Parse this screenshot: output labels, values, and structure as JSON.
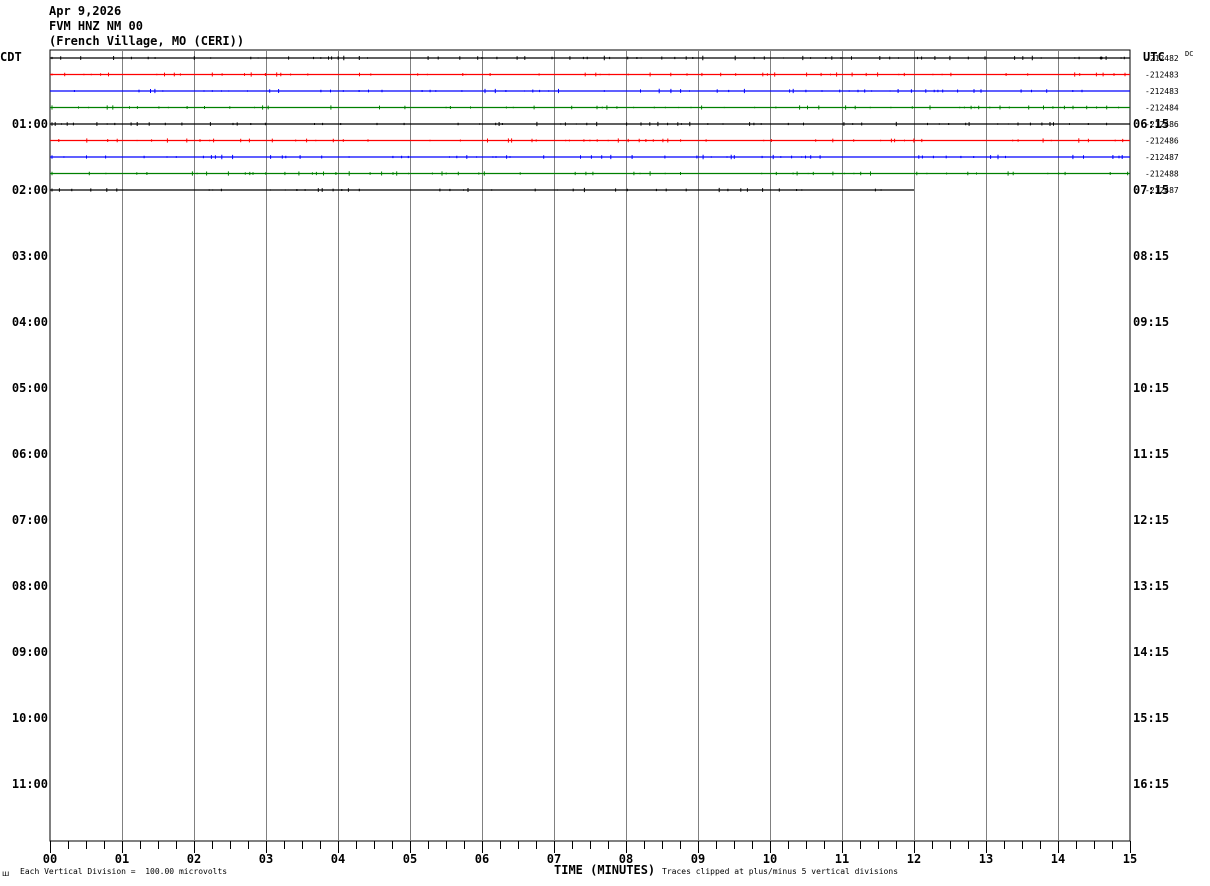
{
  "header": {
    "date": "Apr 9,2026",
    "station": "FVM HNZ NM 00",
    "location": "(French Village, MO (CERI))"
  },
  "left_zone_label": "CDT",
  "right_zone_label": "UTC",
  "dc_label": "DC",
  "footer": {
    "scale_note": "Each Vertical Division =  100.00 microvolts",
    "xlabel": "TIME (MINUTES)",
    "clip_note": "Traces clipped at plus/minus 5 vertical divisions",
    "corner_mark": "ꟺ"
  },
  "chart_data": {
    "type": "line",
    "title": "",
    "xlabel": "TIME (MINUTES)",
    "x_range": [
      0,
      15
    ],
    "x_ticks": [
      "00",
      "01",
      "02",
      "03",
      "04",
      "05",
      "06",
      "07",
      "08",
      "09",
      "10",
      "11",
      "12",
      "13",
      "14",
      "15"
    ],
    "grid_vertical": true,
    "rows_total": 48,
    "left_time_labels": [
      {
        "row": 4,
        "label": "01:00"
      },
      {
        "row": 8,
        "label": "02:00"
      },
      {
        "row": 12,
        "label": "03:00"
      },
      {
        "row": 16,
        "label": "04:00"
      },
      {
        "row": 20,
        "label": "05:00"
      },
      {
        "row": 24,
        "label": "06:00"
      },
      {
        "row": 28,
        "label": "07:00"
      },
      {
        "row": 32,
        "label": "08:00"
      },
      {
        "row": 36,
        "label": "09:00"
      },
      {
        "row": 40,
        "label": "10:00"
      },
      {
        "row": 44,
        "label": "11:00"
      }
    ],
    "right_time_labels": [
      {
        "row": 4,
        "label": "06:15"
      },
      {
        "row": 8,
        "label": "07:15"
      },
      {
        "row": 12,
        "label": "08:15"
      },
      {
        "row": 16,
        "label": "09:15"
      },
      {
        "row": 20,
        "label": "10:15"
      },
      {
        "row": 24,
        "label": "11:15"
      },
      {
        "row": 28,
        "label": "12:15"
      },
      {
        "row": 32,
        "label": "13:15"
      },
      {
        "row": 36,
        "label": "14:15"
      },
      {
        "row": 40,
        "label": "15:15"
      },
      {
        "row": 44,
        "label": "16:15"
      }
    ],
    "traces": [
      {
        "row": 0,
        "color": "#000000",
        "end_minute": 15,
        "dc": "-212482"
      },
      {
        "row": 1,
        "color": "#ff0000",
        "end_minute": 15,
        "dc": "-212483"
      },
      {
        "row": 2,
        "color": "#0000ff",
        "end_minute": 15,
        "dc": "-212483"
      },
      {
        "row": 3,
        "color": "#008000",
        "end_minute": 15,
        "dc": "-212484"
      },
      {
        "row": 4,
        "color": "#000000",
        "end_minute": 15,
        "dc": "-212486"
      },
      {
        "row": 5,
        "color": "#ff0000",
        "end_minute": 15,
        "dc": "-212486"
      },
      {
        "row": 6,
        "color": "#0000ff",
        "end_minute": 15,
        "dc": "-212487"
      },
      {
        "row": 7,
        "color": "#008000",
        "end_minute": 15,
        "dc": "-212488"
      },
      {
        "row": 8,
        "color": "#000000",
        "end_minute": 12,
        "dc": "-212487"
      }
    ],
    "colors": {
      "grid": "#808080",
      "frame": "#000000"
    }
  }
}
